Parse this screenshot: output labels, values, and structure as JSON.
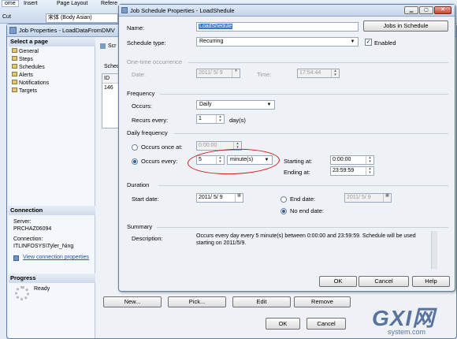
{
  "ribbon": {
    "tabs": [
      "ome",
      "Insert",
      "Page Layout",
      "Refere"
    ],
    "font": "宋体 (Body Asian)",
    "cut": "Cut"
  },
  "job_props": {
    "title": "Job Properties - LoadDataFromDMV",
    "select_page": "Select a page",
    "pages": [
      "General",
      "Steps",
      "Schedules",
      "Alerts",
      "Notifications",
      "Targets"
    ],
    "connection_header": "Connection",
    "server_label": "Server:",
    "server_value": "PRCHAZ06094",
    "connection_label": "Connection:",
    "connection_value": "ITLINFOSYS\\Tyler_Ning",
    "view_link": "View connection properties",
    "progress_header": "Progress",
    "progress_status": "Ready",
    "toolbar_fragment": "Scr",
    "sched_fragment": "Sched",
    "grid_header": "ID",
    "grid_value": "146",
    "new_button": "New...",
    "pick_button": "Pick...",
    "edit_button": "Edit",
    "remove_button": "Remove",
    "ok_button": "OK",
    "cancel_button": "Cancel"
  },
  "schedule": {
    "title": "Job Schedule Properties - LoadShedule",
    "name_label": "Name:",
    "name_value": "LoadShedule",
    "jobs_button": "Jobs in Schedule",
    "type_label": "Schedule type:",
    "type_value": "Recurring",
    "enabled_label": "Enabled",
    "enabled": true,
    "onetime_header": "One-time occurrence",
    "onetime_date_label": "Date:",
    "onetime_date": "2011/ 5/ 9",
    "onetime_time_label": "Time:",
    "onetime_time": "17:54:44",
    "frequency_header": "Frequency",
    "occurs_label": "Occurs:",
    "occurs_value": "Daily",
    "recurs_label": "Recurs every:",
    "recurs_value": "1",
    "recurs_unit": "day(s)",
    "daily_header": "Daily frequency",
    "once_label": "Occurs once at:",
    "once_value": "0:00:00",
    "every_label": "Occurs every:",
    "every_value": "5",
    "every_unit": "minute(s)",
    "starting_label": "Starting at:",
    "starting_value": "0:00:00",
    "ending_label": "Ending at:",
    "ending_value": "23:59:59",
    "duration_header": "Duration",
    "start_label": "Start date:",
    "start_value": "2011/ 5/ 9",
    "end_label": "End date:",
    "end_value": "2011/ 5/ 9",
    "noend_label": "No end date:",
    "summary_header": "Summary",
    "desc_label": "Description:",
    "desc_value": "Occurs every day every 5 minute(s) between 0:00:00 and 23:59:59. Schedule will be used starting on 2011/5/9.",
    "ok_button": "OK",
    "cancel_button": "Cancel",
    "help_button": "Help"
  },
  "watermark": {
    "logo": "GXI网",
    "site": "system.com"
  },
  "colors": {
    "highlight_circle": "#cc1a1a",
    "selection": "#3a77c8",
    "watermark": "#3f5f8f"
  }
}
